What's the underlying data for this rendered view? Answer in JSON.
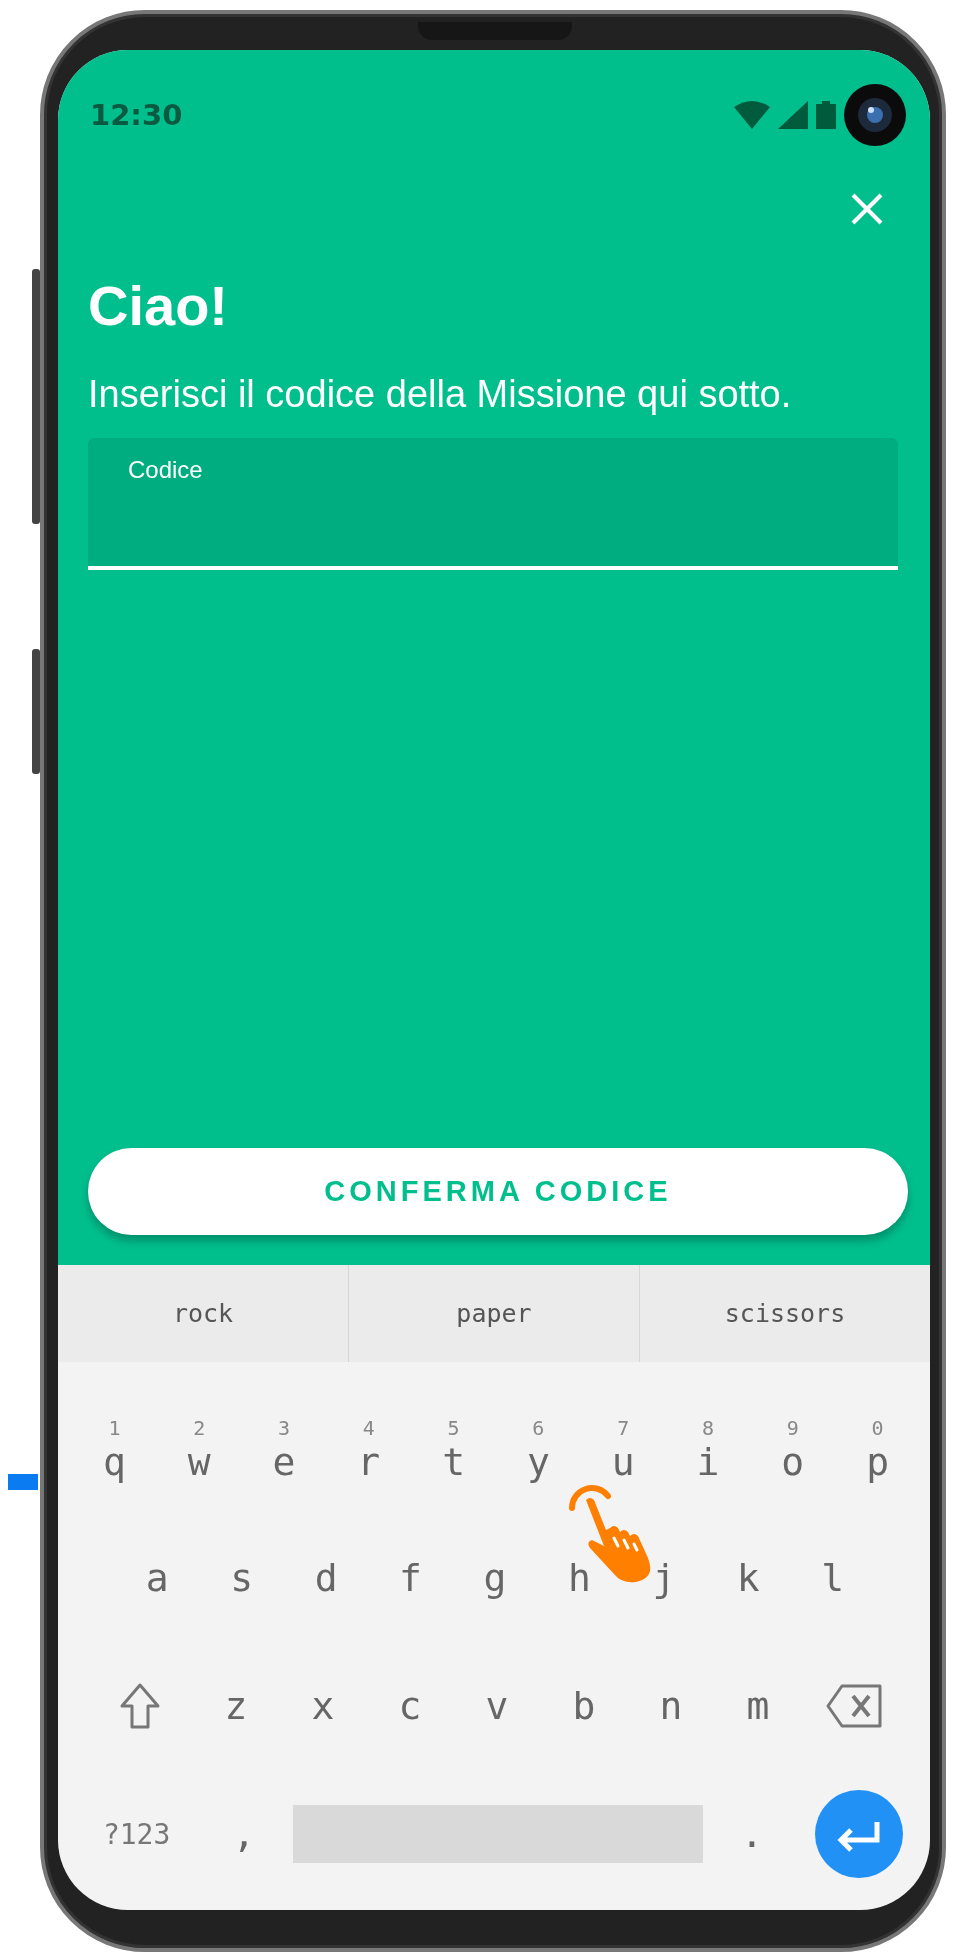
{
  "status_bar": {
    "time": "12:30"
  },
  "title": "Ciao!",
  "subtitle": "Inserisci il codice della Missione qui sotto.",
  "code_field": {
    "label": "Codice"
  },
  "confirm_button": {
    "label": "CONFERMA CODICE"
  },
  "suggestions": [
    "rock",
    "paper",
    "scissors"
  ],
  "keyboard": {
    "rows": [
      {
        "keys": [
          {
            "kind": "letter",
            "label": "q",
            "hint": "1"
          },
          {
            "kind": "letter",
            "label": "w",
            "hint": "2"
          },
          {
            "kind": "letter",
            "label": "e",
            "hint": "3"
          },
          {
            "kind": "letter",
            "label": "r",
            "hint": "4"
          },
          {
            "kind": "letter",
            "label": "t",
            "hint": "5"
          },
          {
            "kind": "letter",
            "label": "y",
            "hint": "6"
          },
          {
            "kind": "letter",
            "label": "u",
            "hint": "7"
          },
          {
            "kind": "letter",
            "label": "i",
            "hint": "8"
          },
          {
            "kind": "letter",
            "label": "o",
            "hint": "9"
          },
          {
            "kind": "letter",
            "label": "p",
            "hint": "0"
          }
        ]
      },
      {
        "keys": [
          {
            "kind": "letter",
            "label": "a"
          },
          {
            "kind": "letter",
            "label": "s"
          },
          {
            "kind": "letter",
            "label": "d"
          },
          {
            "kind": "letter",
            "label": "f"
          },
          {
            "kind": "letter",
            "label": "g"
          },
          {
            "kind": "letter",
            "label": "h"
          },
          {
            "kind": "letter",
            "label": "j"
          },
          {
            "kind": "letter",
            "label": "k"
          },
          {
            "kind": "letter",
            "label": "l"
          }
        ]
      },
      {
        "keys": [
          {
            "kind": "shift"
          },
          {
            "kind": "letter",
            "label": "z"
          },
          {
            "kind": "letter",
            "label": "x"
          },
          {
            "kind": "letter",
            "label": "c"
          },
          {
            "kind": "letter",
            "label": "v"
          },
          {
            "kind": "letter",
            "label": "b"
          },
          {
            "kind": "letter",
            "label": "n"
          },
          {
            "kind": "letter",
            "label": "m"
          },
          {
            "kind": "backspace"
          }
        ]
      },
      {
        "keys": [
          {
            "kind": "symbols",
            "label": "?123"
          },
          {
            "kind": "letter",
            "label": ","
          },
          {
            "kind": "space"
          },
          {
            "kind": "letter",
            "label": "."
          },
          {
            "kind": "enter"
          }
        ]
      }
    ]
  }
}
